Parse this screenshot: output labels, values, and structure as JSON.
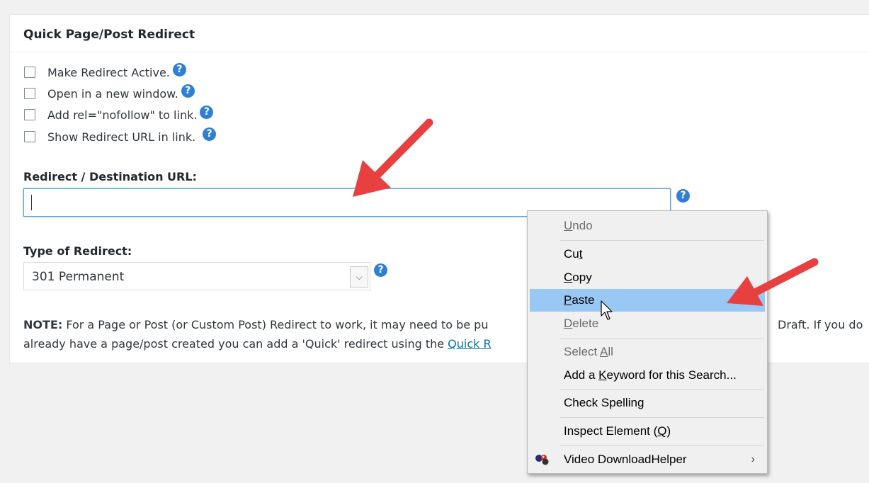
{
  "panel": {
    "title": "Quick Page/Post Redirect"
  },
  "options": [
    {
      "label": "Make Redirect Active."
    },
    {
      "label": "Open in a new window."
    },
    {
      "label": "Add rel=\"nofollow\" to link."
    },
    {
      "label": "Show Redirect URL in link."
    }
  ],
  "help_icon_glyph": "?",
  "url_field": {
    "label": "Redirect / Destination URL:",
    "value": ""
  },
  "redirect_type": {
    "label": "Type of Redirect:",
    "selected": "301 Permanent"
  },
  "note": {
    "bold": "NOTE:",
    "line1": " For a Page or Post (or Custom Post) Redirect to work, it may need to be pu",
    "line1_end": "Draft. If you do",
    "line2": "already have a page/post created you can add a 'Quick' redirect using the ",
    "link": "Quick R"
  },
  "context_menu": {
    "items": [
      {
        "label": "Undo",
        "disabled": true
      },
      {
        "label": "Cut",
        "disabled": false
      },
      {
        "label": "Copy",
        "disabled": false
      },
      {
        "label": "Paste",
        "disabled": false,
        "highlighted": true
      },
      {
        "label": "Delete",
        "disabled": true
      },
      {
        "label": "Select All",
        "disabled": true
      },
      {
        "label": "Add a Keyword for this Search...",
        "disabled": false
      },
      {
        "label": "Check Spelling",
        "disabled": false
      },
      {
        "label": "Inspect Element (Q)",
        "disabled": false
      },
      {
        "label": "Video DownloadHelper",
        "disabled": false,
        "has_submenu": true,
        "icon": "video-downloadhelper-icon"
      }
    ],
    "submenu_arrow": "›"
  },
  "colors": {
    "accent": "#2e7fd6",
    "highlight": "#9ac8f5",
    "annotation_arrow": "#e8403f",
    "link": "#0073aa"
  }
}
